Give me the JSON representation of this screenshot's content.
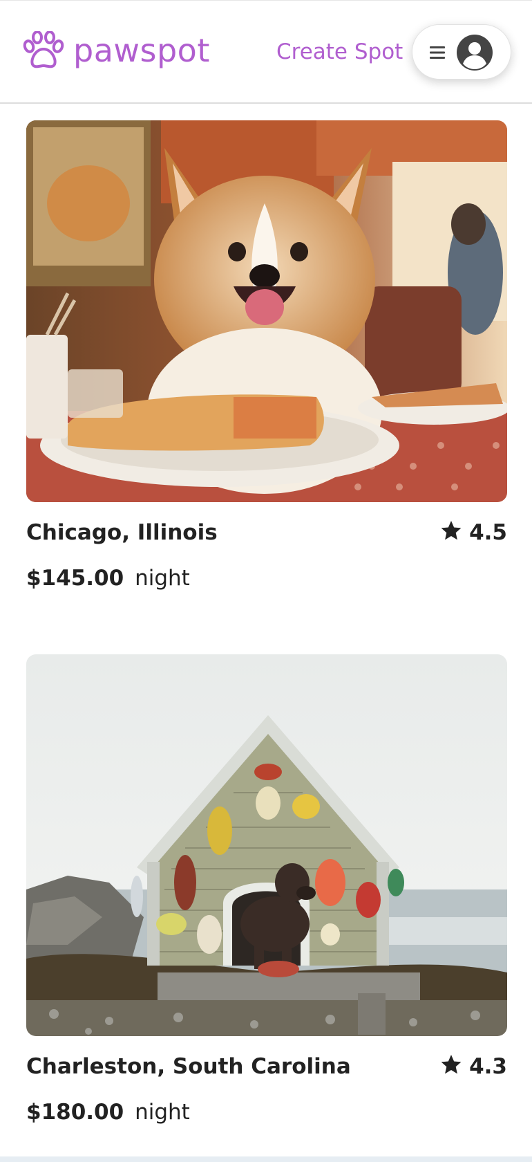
{
  "header": {
    "logo_text": "pawspot",
    "logo_icon": "paw-icon",
    "create_spot_label": "Create Spot",
    "menu_icon": "hamburger-icon",
    "avatar_icon": "user-avatar-icon",
    "brand_color": "#b05ecf"
  },
  "listings": [
    {
      "image": "corgi-at-diner-table",
      "location": "Chicago, Illinois",
      "rating": "4.5",
      "price": "$145.00",
      "price_unit": "night"
    },
    {
      "image": "black-labrador-in-beach-doghouse",
      "location": "Charleston, South Carolina",
      "rating": "4.3",
      "price": "$180.00",
      "price_unit": "night"
    }
  ],
  "rating_icon": "star-icon"
}
